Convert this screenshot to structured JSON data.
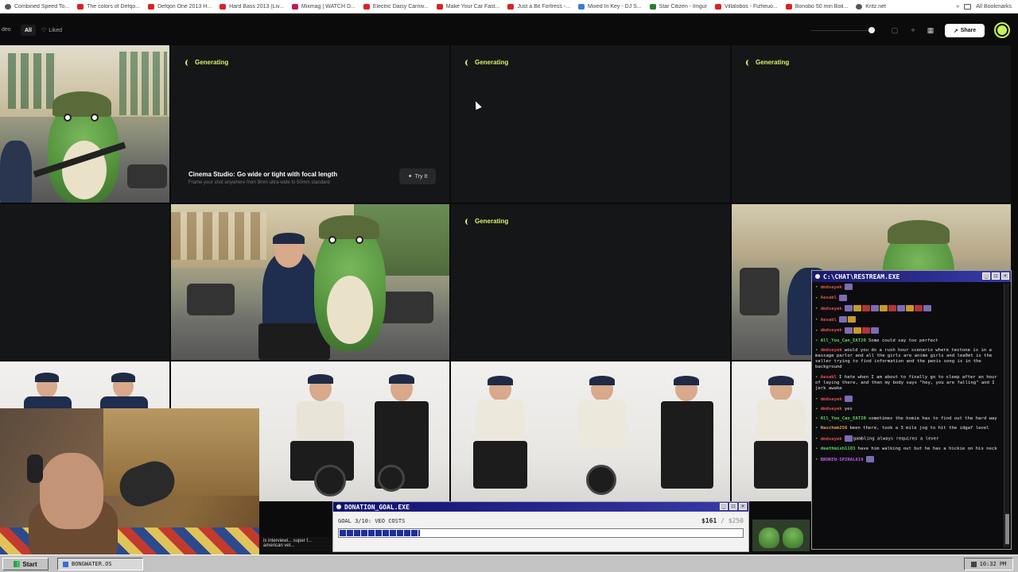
{
  "bookmarks": [
    {
      "label": "Combined Speed To...",
      "icon": "feather-icon"
    },
    {
      "label": "The colors of Defqo...",
      "icon": "youtube-icon"
    },
    {
      "label": "Defqon One 2013 H...",
      "icon": "youtube-icon"
    },
    {
      "label": "Hard Bass 2013 (Liv...",
      "icon": "youtube-icon"
    },
    {
      "label": "Mixmag | WATCH D...",
      "icon": "mixmag-icon"
    },
    {
      "label": "Electric Daisy Carniv...",
      "icon": "youtube-icon"
    },
    {
      "label": "Make Your Car Fast...",
      "icon": "youtube-icon"
    },
    {
      "label": "Just a Bit Fortress -...",
      "icon": "youtube-icon"
    },
    {
      "label": "Mixed In Key - DJ S...",
      "icon": "globe-icon"
    },
    {
      "label": "Star Citizen - Imgur",
      "icon": "imgur-icon"
    },
    {
      "label": "Villalobos - Fizheuo...",
      "icon": "youtube-icon"
    },
    {
      "label": "Bonobo 50 min Boil...",
      "icon": "youtube-icon"
    },
    {
      "label": "Kritz.net",
      "icon": "page-icon"
    }
  ],
  "bookmarks_more": "»",
  "all_bookmarks": "All Bookmarks",
  "toolbar": {
    "video_label": "deo",
    "tab_all": "All",
    "tab_liked": "Liked",
    "share_label": "Share"
  },
  "generating_label": "Generating",
  "promo": {
    "title": "Cinema Studio: Go wide or tight with focal length",
    "subtitle": "Frame your shot anywhere from 8mm ultra-wide to 50mm standard",
    "cta": "Try It"
  },
  "chat": {
    "title": "C:\\CHAT\\RESTREAM.EXE",
    "messages": [
      {
        "user": "dmdseyek",
        "text": "",
        "emotes": 1,
        "color": "#e05050"
      },
      {
        "user": "Aesabl",
        "text": "",
        "emotes": 1,
        "color": "#e05050"
      },
      {
        "user": "dmdseyek",
        "text": "",
        "emotes": 10,
        "color": "#e05050"
      },
      {
        "user": "Aesabl",
        "text": "",
        "emotes": 2,
        "color": "#e05050"
      },
      {
        "user": "dmdseyek",
        "text": "",
        "emotes": 4,
        "color": "#e05050"
      },
      {
        "user": "All_You_Can_EAT20",
        "text": "Some could say too perfect",
        "emotes": 0,
        "color": "#5fd35f"
      },
      {
        "user": "dmdseyek",
        "text": "would you do a rush hour scenario where tectone is in a massage parlor and all the girls are anime girls and lea0et is the seller trying to find information and the penis song is in the background",
        "emotes": 0,
        "color": "#e05050"
      },
      {
        "user": "Aesabl",
        "text": "I hate when I am about to finally go to sleep after an hour of laying there, and then my body says \"hey, you are falling\" and I jerk awake",
        "emotes": 0,
        "color": "#e05050"
      },
      {
        "user": "dmdseyek",
        "text": "",
        "emotes": 1,
        "color": "#e05050"
      },
      {
        "user": "dmdseyek",
        "text": "yes",
        "emotes": 0,
        "color": "#e05050"
      },
      {
        "user": "All_You_Can_EAT20",
        "text": "sometimes the homie has to find out the hard way",
        "emotes": 0,
        "color": "#5fd35f"
      },
      {
        "user": "Naschem256",
        "text": "been there, took a 3 mile jog to hit the idgaf level",
        "emotes": 0,
        "color": "#e0a050"
      },
      {
        "user": "dmdseyek",
        "text": "gambling always requires a lever",
        "emotes": 1,
        "color": "#e05050"
      },
      {
        "user": "deathmish1103",
        "text": "have him walking out but he has a hickie on his neck",
        "emotes": 0,
        "color": "#5fd35f"
      },
      {
        "user": "BROKEN-SPIRAL619",
        "text": "",
        "emotes": 1,
        "color": "#c060e0"
      }
    ]
  },
  "donation": {
    "title": "DONATION_GOAL.EXE",
    "label": "GOAL 3/10: VEO COSTS",
    "current": "$161",
    "goal": "/ $250",
    "progress": 0.2
  },
  "ticker_text": "is interviewi... super f... american vet...",
  "taskbar": {
    "start": "Start",
    "app": "BONGWATER.OS",
    "time": "10:32 PM"
  },
  "colors": {
    "accent": "#d6f36a",
    "window_title": "#1a1a6e",
    "donation_fill": "#1d2e9e"
  }
}
